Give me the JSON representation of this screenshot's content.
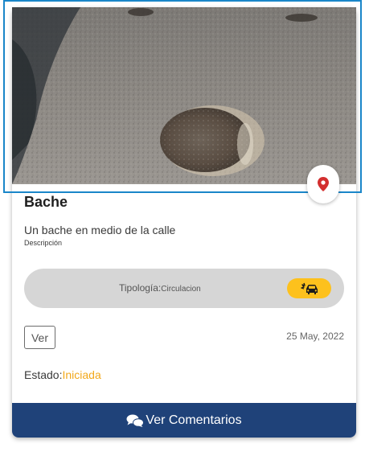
{
  "card": {
    "title": "Bache",
    "description": "Un bache en medio de la calle",
    "description_label": "Descripción",
    "tipologia_label": "Tipología:",
    "tipologia_value": "Circulacion",
    "tipologia_icon": "car-crash-icon",
    "view_button": "Ver",
    "date": "25 May, 2022",
    "estado_label": "Estado:",
    "estado_value": "Iniciada",
    "map_icon": "map-pin-icon",
    "comments_button": "Ver Comentarios",
    "comments_icon": "comments-icon"
  },
  "colors": {
    "accent_blue": "#1f4279",
    "frame_blue": "#1a86c9",
    "badge_yellow": "#fdc11d",
    "status_orange": "#f2a81b",
    "pin_red": "#d32f2f"
  }
}
